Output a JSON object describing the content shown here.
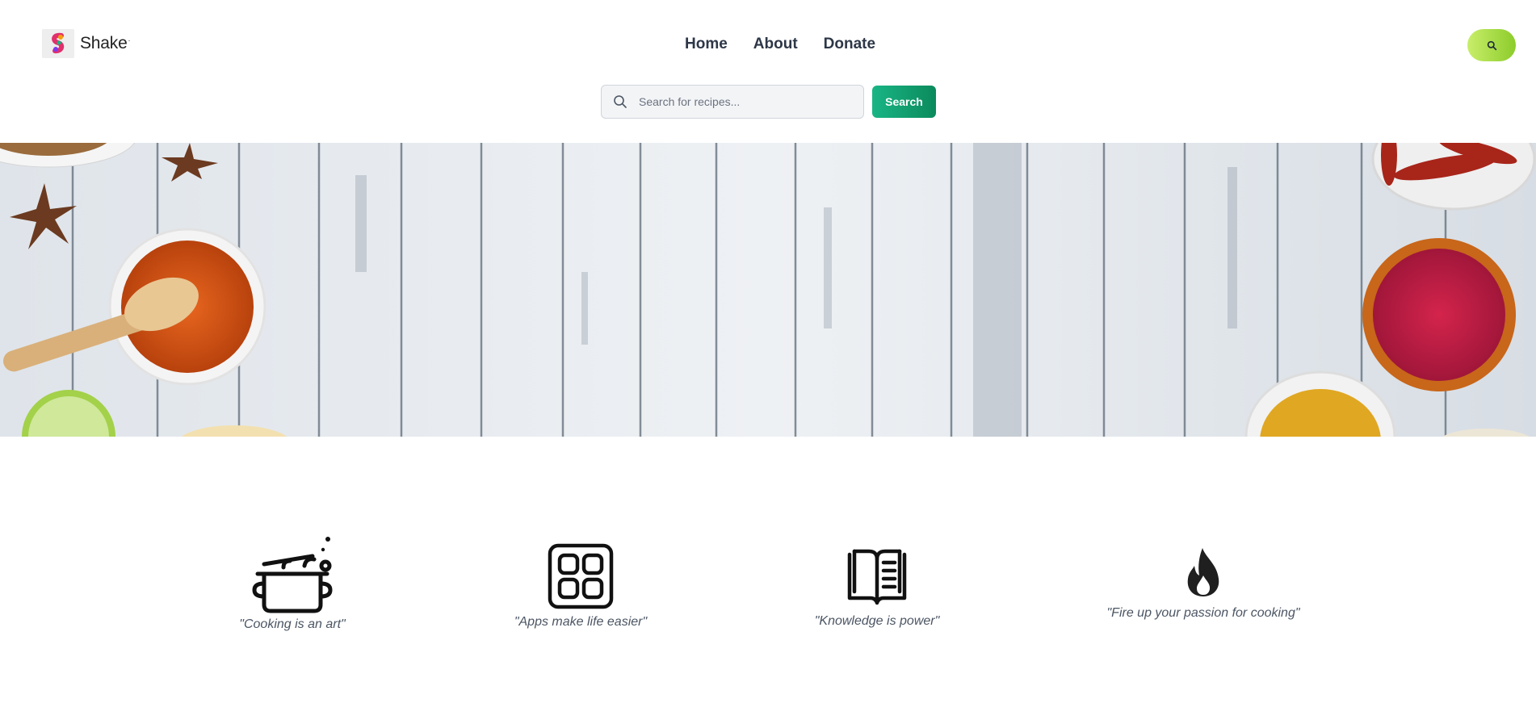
{
  "brand": {
    "name": "Shake",
    "trademark": "·"
  },
  "nav": {
    "items": [
      {
        "label": "Home"
      },
      {
        "label": "About"
      },
      {
        "label": "Donate"
      }
    ]
  },
  "search": {
    "placeholder": "Search for recipes...",
    "value": "",
    "button_label": "Search"
  },
  "hero": {
    "image": "spices-on-white-wooden-table"
  },
  "features": [
    {
      "icon": "cooking-pot-icon",
      "quote": "\"Cooking is an art\""
    },
    {
      "icon": "apps-grid-icon",
      "quote": "\"Apps make life easier\""
    },
    {
      "icon": "open-book-icon",
      "quote": "\"Knowledge is power\""
    },
    {
      "icon": "flame-icon",
      "quote": "\"Fire up your passion for cooking\""
    }
  ],
  "colors": {
    "search_button": "#0f9e6e",
    "top_button": "#a8dd45",
    "nav_text": "#2d3748"
  }
}
